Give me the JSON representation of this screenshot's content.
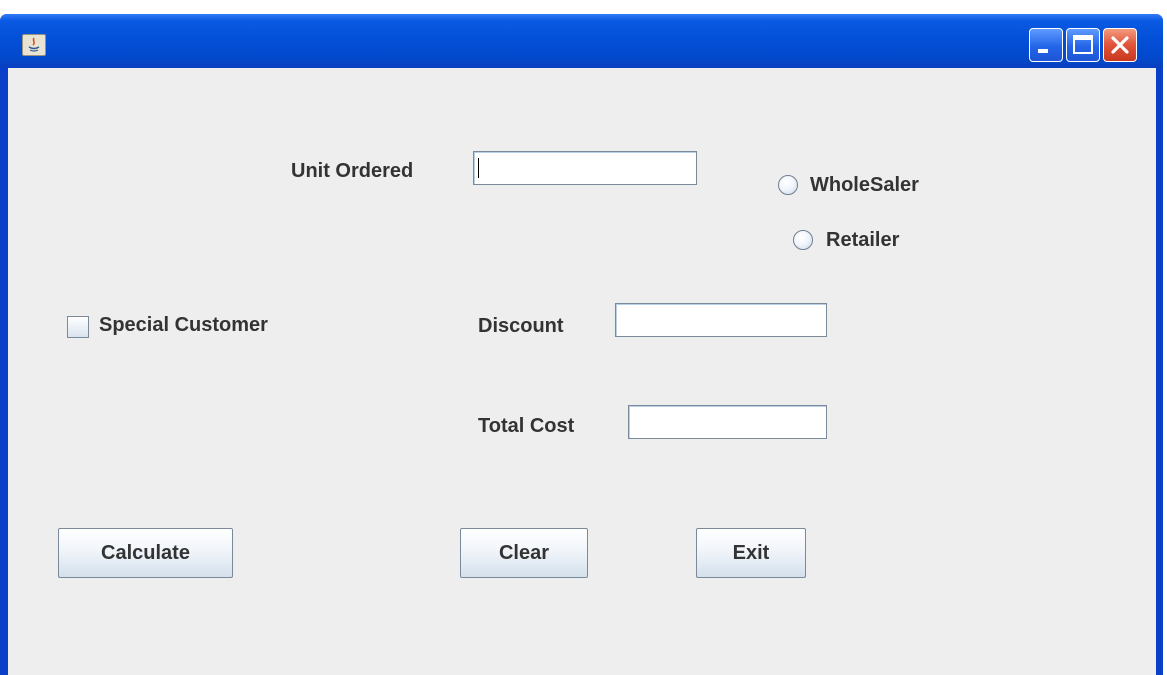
{
  "window": {
    "title": "",
    "controls": {
      "minimize_icon": "minimize-icon",
      "maximize_icon": "maximize-icon",
      "close_icon": "close-icon"
    }
  },
  "form": {
    "unit_ordered_label": "Unit Ordered",
    "unit_ordered_value": "",
    "wholesaler_label": "WholeSaler",
    "retailer_label": "Retailer",
    "special_customer_label": "Special Customer",
    "discount_label": "Discount",
    "discount_value": "",
    "total_cost_label": "Total Cost",
    "total_cost_value": ""
  },
  "buttons": {
    "calculate": "Calculate",
    "clear": "Clear",
    "exit": "Exit"
  },
  "colors": {
    "titlebar": "#0350d8",
    "client_background": "#eeeeee",
    "close_button": "#e0543a"
  }
}
